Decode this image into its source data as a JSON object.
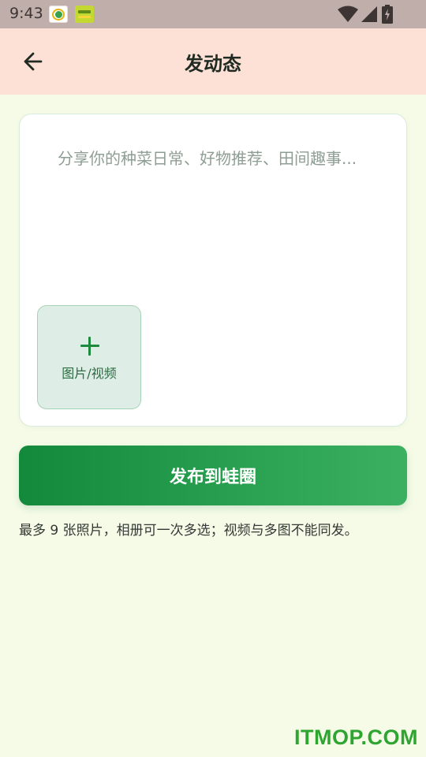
{
  "status_bar": {
    "time": "9:43"
  },
  "header": {
    "title": "发动态",
    "back_icon": "arrow-left-icon"
  },
  "composer": {
    "placeholder": "分享你的种菜日常、好物推荐、田间趣事...",
    "value": "",
    "media_button_label": "图片/视频",
    "media_button_icon": "plus-icon"
  },
  "publish_button": {
    "label": "发布到蛙圈"
  },
  "hint": "最多 9 张照片，相册可一次多选；视频与多图不能同发。",
  "watermark": "ITMOP.COM",
  "colors": {
    "primary": "#1e8a3e",
    "header_bg": "#fde1d6",
    "page_bg": "#f6fbe8"
  }
}
